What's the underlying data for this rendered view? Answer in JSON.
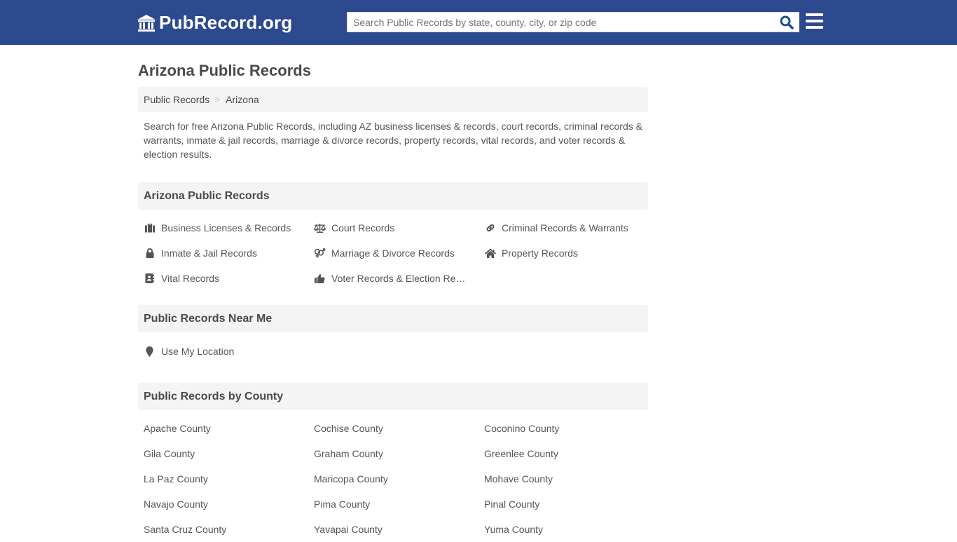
{
  "header": {
    "logo_text": "PubRecord.org",
    "logo_icon": "courthouse-icon",
    "search": {
      "placeholder": "Search Public Records by state, county, city, or zip code",
      "value": ""
    },
    "search_icon": "search-icon",
    "menu_icon": "hamburger-menu-icon",
    "colors": {
      "bar": "#2e4a8f",
      "search_icon": "#1f4d8c"
    }
  },
  "page": {
    "title": "Arizona Public Records",
    "breadcrumb": [
      {
        "label": "Public Records"
      },
      {
        "label": "Arizona"
      }
    ],
    "breadcrumb_separator": ">",
    "description": "Search for free Arizona Public Records, including AZ business licenses & records, court records, criminal records & warrants, inmate & jail records, marriage & divorce records, property records, vital records, and voter records & election results."
  },
  "records_section": {
    "heading": "Arizona Public Records",
    "items": [
      {
        "label": "Business Licenses & Records",
        "icon": "briefcase-icon"
      },
      {
        "label": "Court Records",
        "icon": "scales-icon"
      },
      {
        "label": "Criminal Records & Warrants",
        "icon": "link-icon"
      },
      {
        "label": "Inmate & Jail Records",
        "icon": "lock-icon"
      },
      {
        "label": "Marriage & Divorce Records",
        "icon": "gender-icon"
      },
      {
        "label": "Property Records",
        "icon": "home-icon"
      },
      {
        "label": "Vital Records",
        "icon": "address-book-icon"
      },
      {
        "label": "Voter Records & Election Results",
        "icon": "thumbs-up-icon"
      }
    ]
  },
  "near_section": {
    "heading": "Public Records Near Me",
    "items": [
      {
        "label": "Use My Location",
        "icon": "map-marker-icon"
      }
    ]
  },
  "county_section": {
    "heading": "Public Records by County",
    "items": [
      "Apache County",
      "Cochise County",
      "Coconino County",
      "Gila County",
      "Graham County",
      "Greenlee County",
      "La Paz County",
      "Maricopa County",
      "Mohave County",
      "Navajo County",
      "Pima County",
      "Pinal County",
      "Santa Cruz County",
      "Yavapai County",
      "Yuma County"
    ]
  }
}
